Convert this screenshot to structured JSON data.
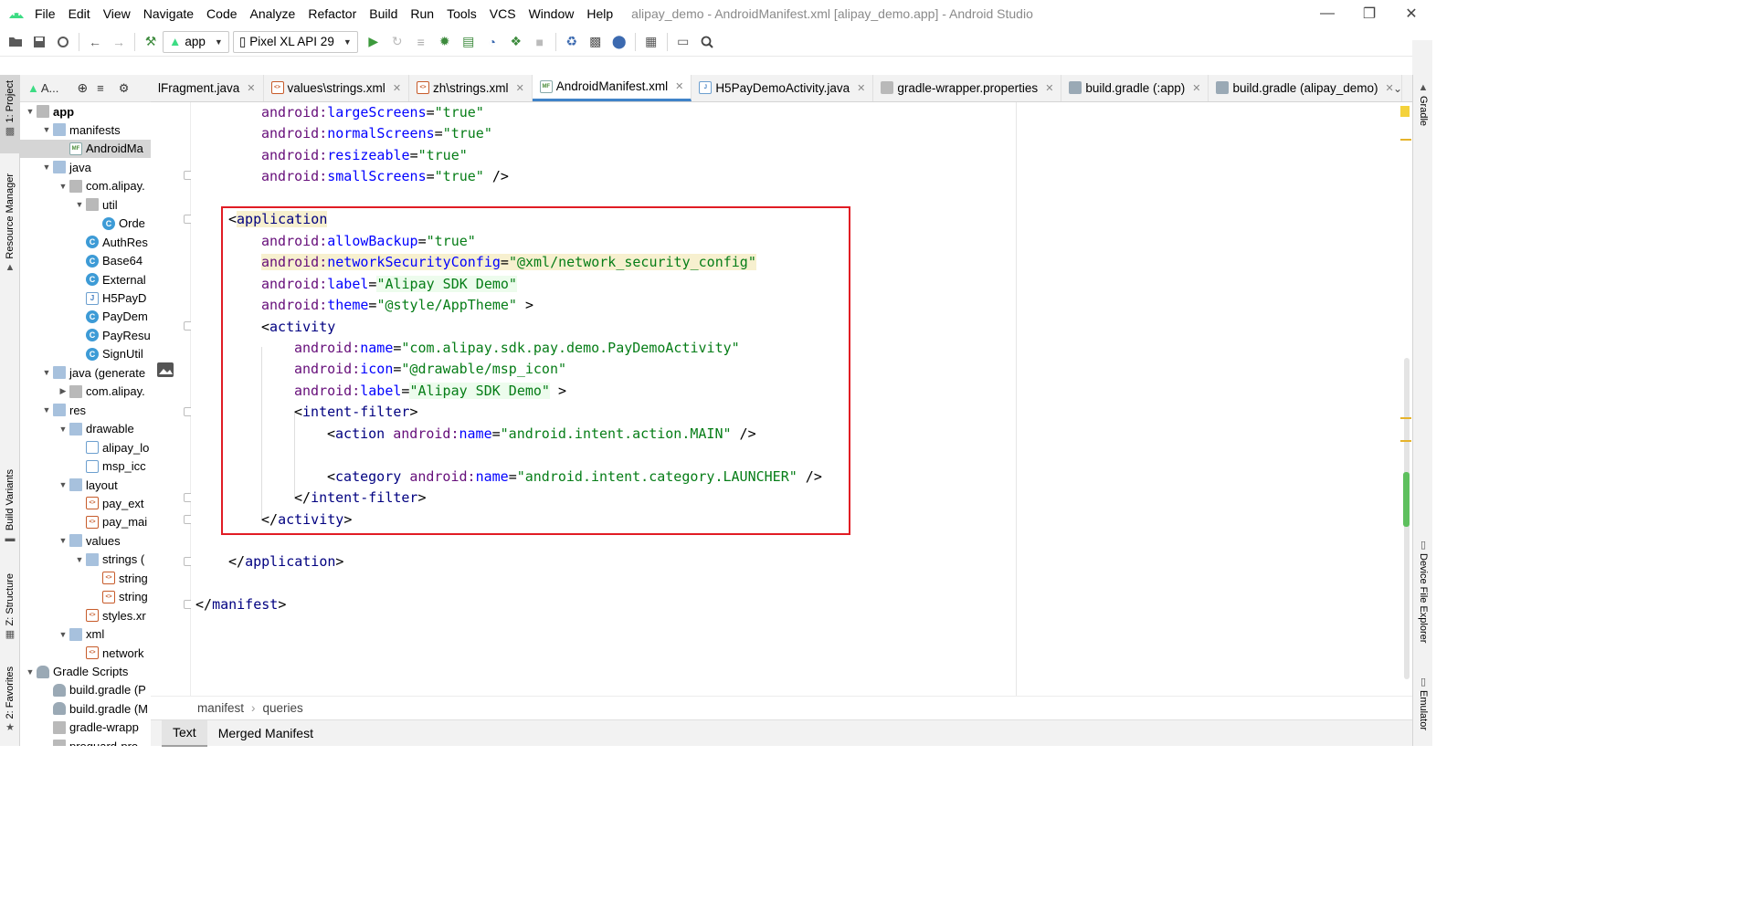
{
  "menu": {
    "items": [
      "File",
      "Edit",
      "View",
      "Navigate",
      "Code",
      "Analyze",
      "Refactor",
      "Build",
      "Run",
      "Tools",
      "VCS",
      "Window",
      "Help"
    ],
    "window_title": "alipay_demo - AndroidManifest.xml [alipay_demo.app] - Android Studio"
  },
  "toolbar": {
    "run_config": "app",
    "device": "Pixel XL API 29"
  },
  "left_tool_windows": {
    "project": "1: Project",
    "resource_manager": "Resource Manager",
    "build_variants": "Build Variants",
    "structure": "Z: Structure",
    "favorites": "2: Favorites"
  },
  "right_tool_windows": {
    "gradle": "Gradle",
    "device_file_explorer": "Device File Explorer",
    "emulator": "Emulator"
  },
  "project_panel": {
    "header": "A..."
  },
  "project_tree": [
    {
      "label": "app",
      "icon": "module-folder",
      "expanded": true,
      "bold": true
    },
    {
      "label": "manifests",
      "icon": "folder",
      "expanded": true
    },
    {
      "label": "AndroidMa",
      "icon": "manifest-file",
      "selected": true
    },
    {
      "label": "java",
      "icon": "folder",
      "expanded": true
    },
    {
      "label": "com.alipay.",
      "icon": "package",
      "expanded": true
    },
    {
      "label": "util",
      "icon": "package",
      "expanded": true
    },
    {
      "label": "Orde",
      "icon": "class"
    },
    {
      "label": "AuthRes",
      "icon": "class"
    },
    {
      "label": "Base64",
      "icon": "class"
    },
    {
      "label": "External",
      "icon": "class"
    },
    {
      "label": "H5PayD",
      "icon": "java-file"
    },
    {
      "label": "PayDem",
      "icon": "class"
    },
    {
      "label": "PayResu",
      "icon": "class"
    },
    {
      "label": "SignUtil",
      "icon": "class"
    },
    {
      "label": "java (generate",
      "icon": "folder",
      "expanded": true
    },
    {
      "label": "com.alipay.",
      "icon": "package",
      "expanded": false
    },
    {
      "label": "res",
      "icon": "folder",
      "expanded": true
    },
    {
      "label": "drawable",
      "icon": "folder",
      "expanded": true
    },
    {
      "label": "alipay_lo",
      "icon": "image-file"
    },
    {
      "label": "msp_icc",
      "icon": "image-file"
    },
    {
      "label": "layout",
      "icon": "folder",
      "expanded": true
    },
    {
      "label": "pay_ext",
      "icon": "xml-file"
    },
    {
      "label": "pay_mai",
      "icon": "xml-file"
    },
    {
      "label": "values",
      "icon": "folder",
      "expanded": true
    },
    {
      "label": "strings (",
      "icon": "folder",
      "expanded": true
    },
    {
      "label": "string",
      "icon": "xml-file"
    },
    {
      "label": "string",
      "icon": "xml-file"
    },
    {
      "label": "styles.xr",
      "icon": "xml-file"
    },
    {
      "label": "xml",
      "icon": "folder",
      "expanded": true
    },
    {
      "label": "network",
      "icon": "xml-file"
    },
    {
      "label": "Gradle Scripts",
      "icon": "gradle",
      "expanded": true
    },
    {
      "label": "build.gradle (P",
      "icon": "gradle"
    },
    {
      "label": "build.gradle (M",
      "icon": "gradle"
    },
    {
      "label": "gradle-wrapp",
      "icon": "properties"
    },
    {
      "label": "proguard-pro",
      "icon": "properties"
    }
  ],
  "editor_tabs": [
    {
      "label": "lFragment.java",
      "icon": "none"
    },
    {
      "label": "values\\strings.xml",
      "icon": "xml"
    },
    {
      "label": "zh\\strings.xml",
      "icon": "xml"
    },
    {
      "label": "AndroidManifest.xml",
      "icon": "manifest",
      "active": true
    },
    {
      "label": "H5PayDemoActivity.java",
      "icon": "java"
    },
    {
      "label": "gradle-wrapper.properties",
      "icon": "properties"
    },
    {
      "label": "build.gradle (:app)",
      "icon": "gradle"
    },
    {
      "label": "build.gradle (alipay_demo)",
      "icon": "gradle"
    }
  ],
  "code_lines": [
    [
      [
        "    ",
        "p"
      ],
      [
        "android:",
        "ns"
      ],
      [
        "largeScreens",
        "an"
      ],
      [
        "=",
        "p"
      ],
      [
        "\"true\"",
        "v"
      ]
    ],
    [
      [
        "    ",
        "p"
      ],
      [
        "android:",
        "ns"
      ],
      [
        "normalScreens",
        "an"
      ],
      [
        "=",
        "p"
      ],
      [
        "\"true\"",
        "v"
      ]
    ],
    [
      [
        "    ",
        "p"
      ],
      [
        "android:",
        "ns"
      ],
      [
        "resizeable",
        "an"
      ],
      [
        "=",
        "p"
      ],
      [
        "\"true\"",
        "v"
      ]
    ],
    [
      [
        "    ",
        "p"
      ],
      [
        "android:",
        "ns"
      ],
      [
        "smallScreens",
        "an"
      ],
      [
        "=",
        "p"
      ],
      [
        "\"true\"",
        "v"
      ],
      [
        " />",
        "p"
      ]
    ],
    [],
    [
      [
        "<",
        "p"
      ],
      [
        "application",
        "ta"
      ]
    ],
    [
      [
        "    ",
        "p"
      ],
      [
        "android:",
        "ns"
      ],
      [
        "allowBackup",
        "an"
      ],
      [
        "=",
        "p"
      ],
      [
        "\"true\"",
        "v"
      ]
    ],
    [
      [
        "    ",
        "p"
      ],
      [
        "android:",
        "ns"
      ],
      [
        "networkSecurityConfig",
        "an"
      ],
      [
        "=",
        "p"
      ],
      [
        "\"@xml/network_security_config\"",
        "v"
      ]
    ],
    [
      [
        "    ",
        "p"
      ],
      [
        "android:",
        "ns"
      ],
      [
        "label",
        "an"
      ],
      [
        "=",
        "p"
      ],
      [
        "\"Alipay SDK Demo\"",
        "v"
      ]
    ],
    [
      [
        "    ",
        "p"
      ],
      [
        "android:",
        "ns"
      ],
      [
        "theme",
        "an"
      ],
      [
        "=",
        "p"
      ],
      [
        "\"@style/AppTheme\"",
        "v"
      ],
      [
        " >",
        "p"
      ]
    ],
    [
      [
        "    ",
        "p"
      ],
      [
        "<",
        "p"
      ],
      [
        "activity",
        "ta"
      ]
    ],
    [
      [
        "        ",
        "p"
      ],
      [
        "android:",
        "ns"
      ],
      [
        "name",
        "an"
      ],
      [
        "=",
        "p"
      ],
      [
        "\"com.alipay.sdk.pay.demo.PayDemoActivity\"",
        "v"
      ]
    ],
    [
      [
        "        ",
        "p"
      ],
      [
        "android:",
        "ns"
      ],
      [
        "icon",
        "an"
      ],
      [
        "=",
        "p"
      ],
      [
        "\"@drawable/msp_icon\"",
        "v"
      ]
    ],
    [
      [
        "        ",
        "p"
      ],
      [
        "android:",
        "ns"
      ],
      [
        "label",
        "an"
      ],
      [
        "=",
        "p"
      ],
      [
        "\"Alipay SDK Demo\"",
        "v"
      ],
      [
        " >",
        "p"
      ]
    ],
    [
      [
        "        ",
        "p"
      ],
      [
        "<",
        "p"
      ],
      [
        "intent-filter",
        "ta"
      ],
      [
        ">",
        "p"
      ]
    ],
    [
      [
        "            ",
        "p"
      ],
      [
        "<",
        "p"
      ],
      [
        "action ",
        "ta"
      ],
      [
        "android:",
        "ns"
      ],
      [
        "name",
        "an"
      ],
      [
        "=",
        "p"
      ],
      [
        "\"android.intent.action.MAIN\"",
        "v"
      ],
      [
        " />",
        "p"
      ]
    ],
    [],
    [
      [
        "            ",
        "p"
      ],
      [
        "<",
        "p"
      ],
      [
        "category ",
        "ta"
      ],
      [
        "android:",
        "ns"
      ],
      [
        "name",
        "an"
      ],
      [
        "=",
        "p"
      ],
      [
        "\"android.intent.category.LAUNCHER\"",
        "v"
      ],
      [
        " />",
        "p"
      ]
    ],
    [
      [
        "        ",
        "p"
      ],
      [
        "</",
        "p"
      ],
      [
        "intent-filter",
        "ta"
      ],
      [
        ">",
        "p"
      ]
    ],
    [
      [
        "    ",
        "p"
      ],
      [
        "</",
        "p"
      ],
      [
        "activity",
        "ta"
      ],
      [
        ">",
        "p"
      ]
    ],
    [],
    [
      [
        "</",
        "p"
      ],
      [
        "application",
        "ta"
      ],
      [
        ">",
        "p"
      ]
    ],
    [],
    [
      [
        "</",
        "p"
      ],
      [
        "manifest",
        "ta"
      ],
      [
        ">",
        "p"
      ]
    ]
  ],
  "breadcrumb": [
    "manifest",
    "queries"
  ],
  "bottom_tabs": {
    "text": "Text",
    "merged": "Merged Manifest"
  }
}
